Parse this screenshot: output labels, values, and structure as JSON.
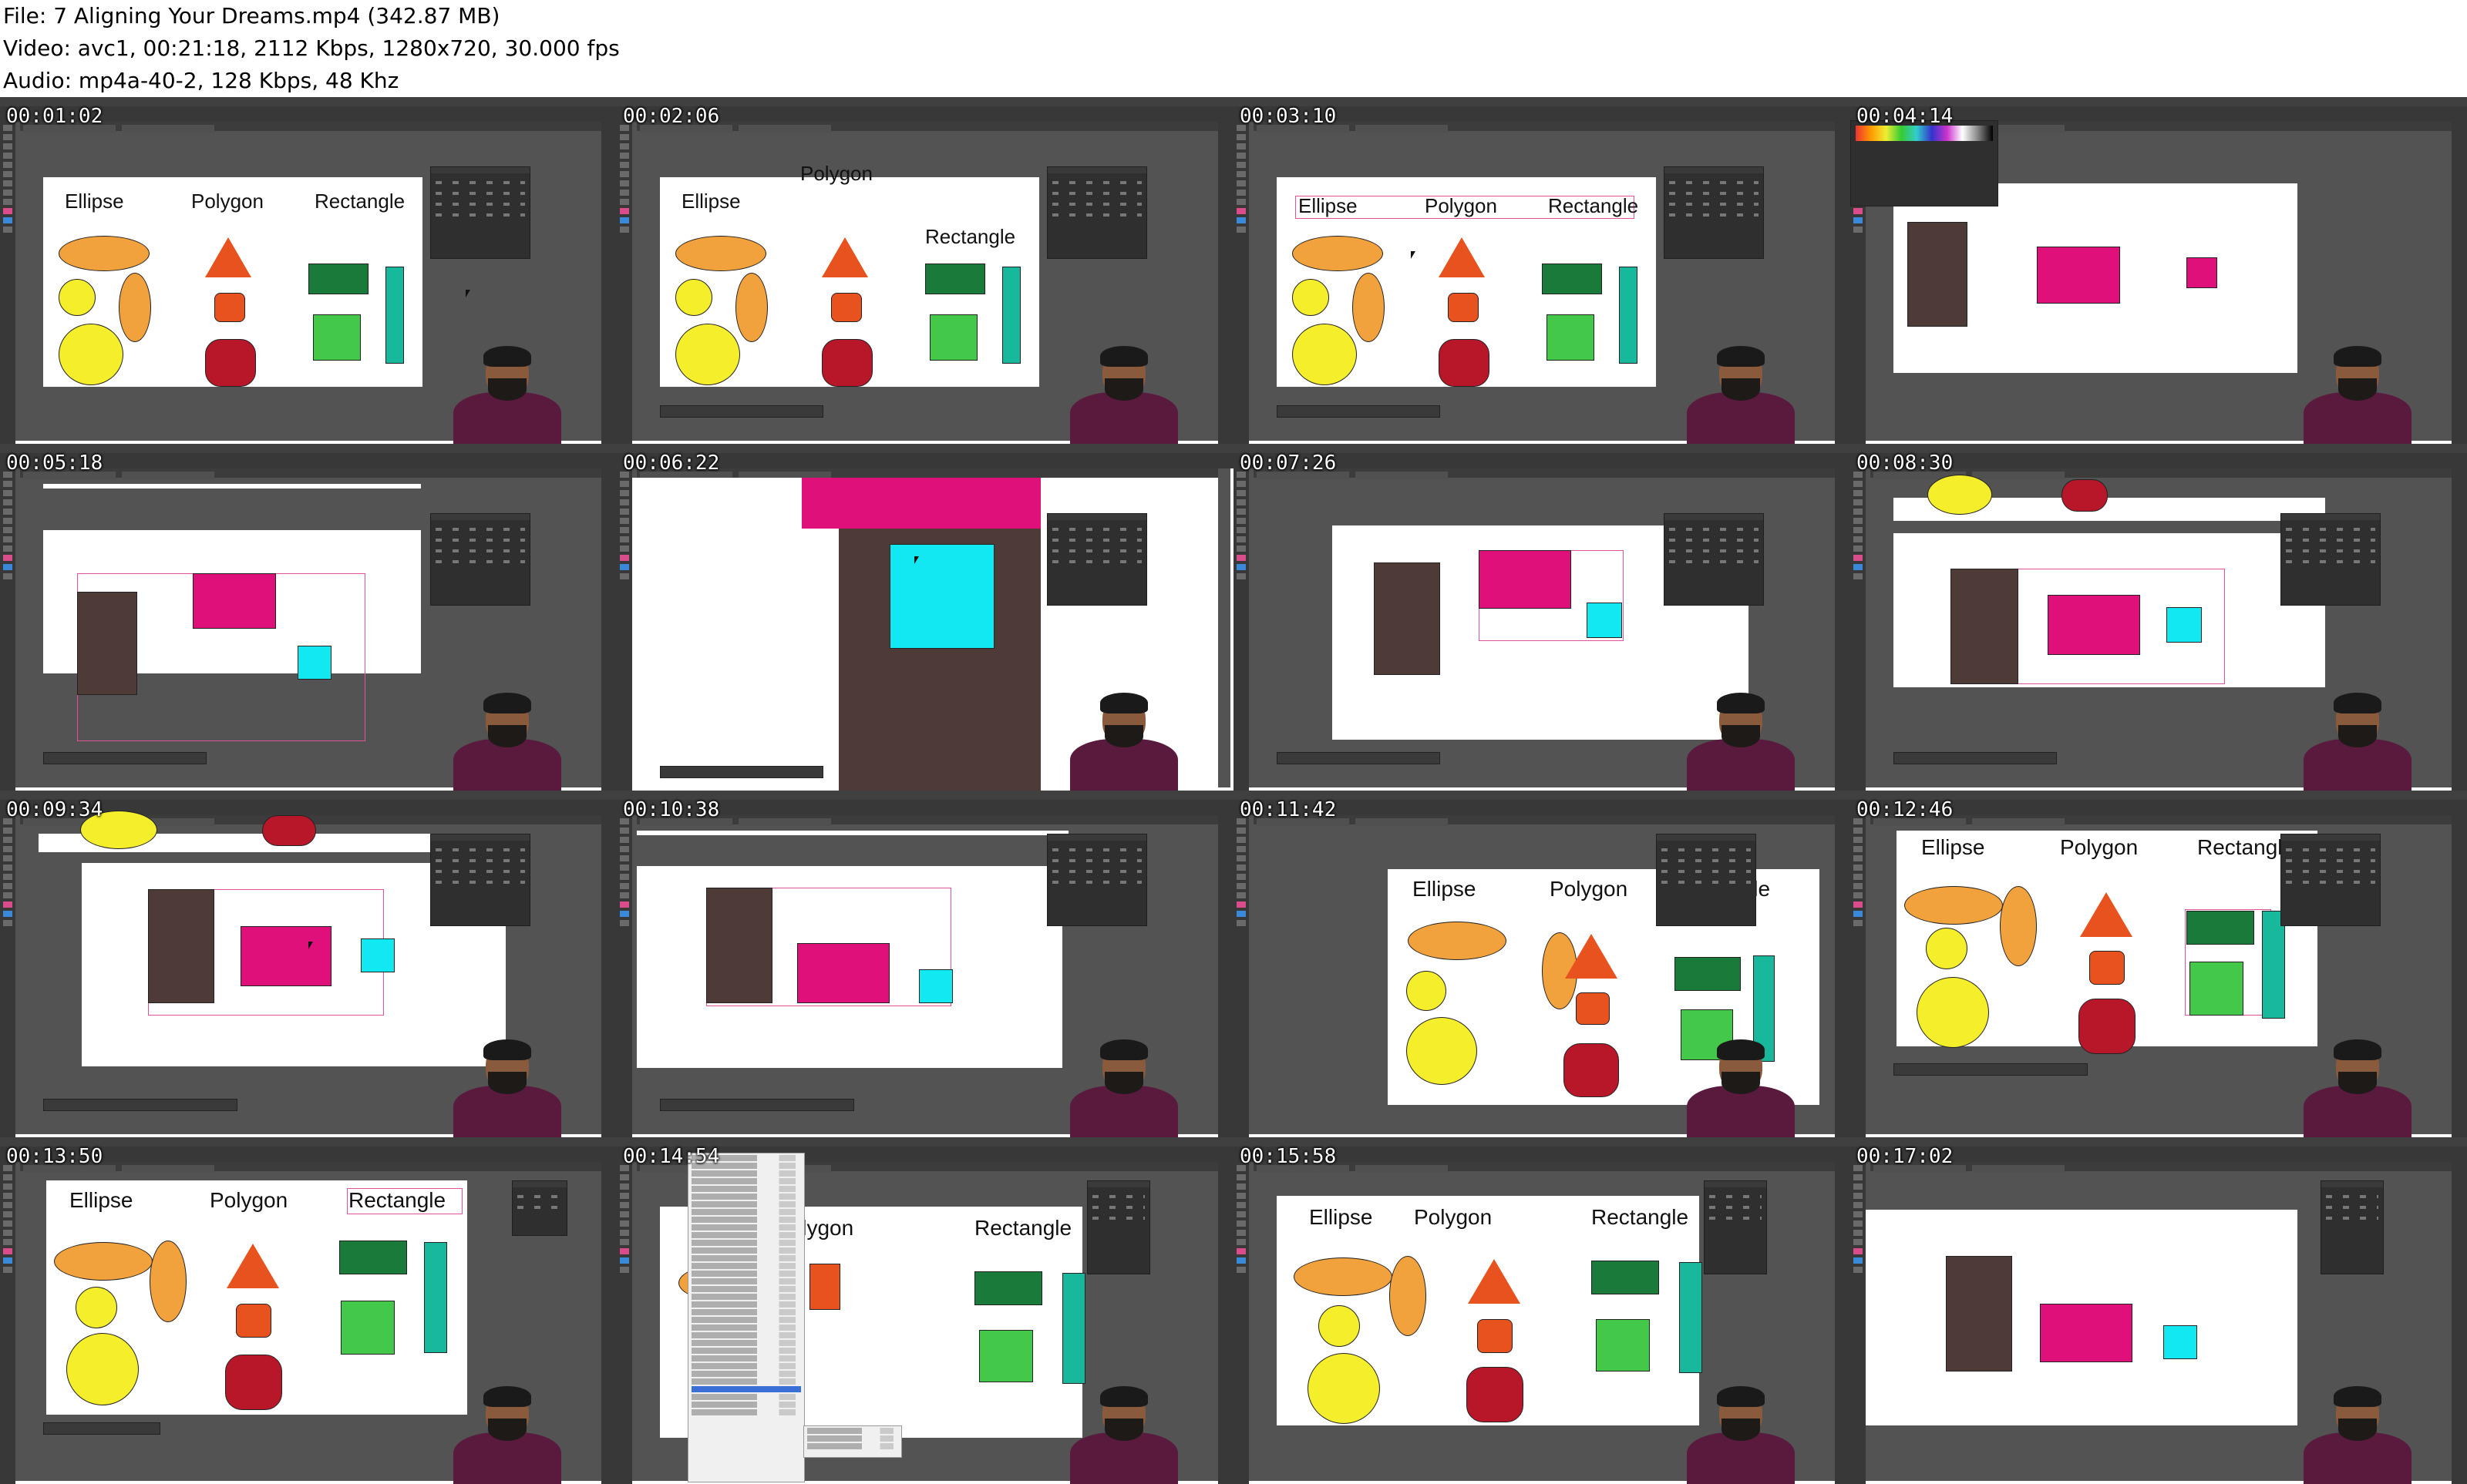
{
  "header": {
    "file_line": "File: 7  Aligning Your Dreams.mp4 (342.87 MB)",
    "video_line": "Video: avc1, 00:21:18, 2112 Kbps, 1280x720, 30.000 fps",
    "audio_line": "Audio: mp4a-40-2, 128 Kbps, 48 Khz"
  },
  "shape_labels": {
    "ellipse": "Ellipse",
    "polygon": "Polygon",
    "rectangle": "Rectangle"
  },
  "colors": {
    "ui_dark": "#535353",
    "orange": "#f2a23c",
    "yellow": "#f5ee2a",
    "red_orange": "#e8521e",
    "crimson": "#b8172a",
    "dark_green": "#1a7a3a",
    "green": "#43c84a",
    "teal": "#17b89c",
    "brown": "#4e3b37",
    "magenta": "#e0107a",
    "cyan": "#12e8f2"
  },
  "thumbnails": [
    {
      "timestamp": "00:01:02"
    },
    {
      "timestamp": "00:02:06"
    },
    {
      "timestamp": "00:03:10"
    },
    {
      "timestamp": "00:04:14"
    },
    {
      "timestamp": "00:05:18"
    },
    {
      "timestamp": "00:06:22"
    },
    {
      "timestamp": "00:07:26"
    },
    {
      "timestamp": "00:08:30"
    },
    {
      "timestamp": "00:09:34"
    },
    {
      "timestamp": "00:10:38"
    },
    {
      "timestamp": "00:11:42"
    },
    {
      "timestamp": "00:12:46"
    },
    {
      "timestamp": "00:13:50"
    },
    {
      "timestamp": "00:14:54"
    },
    {
      "timestamp": "00:15:58"
    },
    {
      "timestamp": "00:17:02"
    }
  ]
}
